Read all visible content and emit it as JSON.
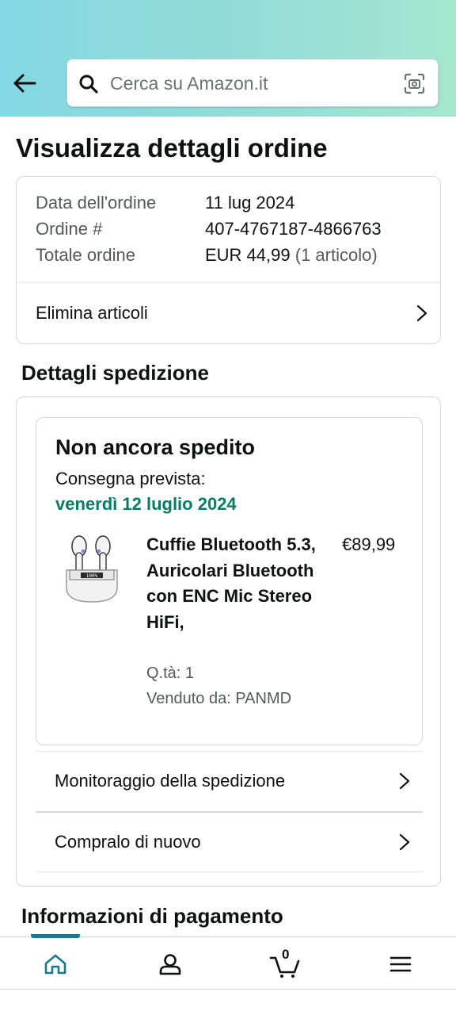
{
  "header": {
    "search_placeholder": "Cerca su Amazon.it"
  },
  "page_title": "Visualizza dettagli ordine",
  "order": {
    "date_label": "Data dell'ordine",
    "date_value": "11 lug 2024",
    "number_label": "Ordine #",
    "number_value": "407-4767187-4866763",
    "total_label": "Totale ordine",
    "total_value": "EUR 44,99",
    "total_items": "(1 articolo)",
    "delete_items_label": "Elimina articoli"
  },
  "shipping": {
    "section_title": "Dettagli spedizione",
    "status": "Non ancora spedito",
    "delivery_label": "Consegna prevista:",
    "delivery_date": "venerdì 12 luglio 2024",
    "product": {
      "name": "Cuffie Bluetooth 5.3, Auricolari Bluetooth con ENC Mic Stereo HiFi,",
      "price": "€89,99",
      "quantity": "Q.tà: 1",
      "seller": "Venduto da: PANMD"
    },
    "track_label": "Monitoraggio della spedizione",
    "buy_again_label": "Compralo di nuovo"
  },
  "payment": {
    "section_title": "Informazioni di pagamento"
  },
  "bottom_nav": {
    "cart_count": "0",
    "items": [
      "home-icon",
      "account-icon",
      "cart-icon",
      "menu-icon"
    ],
    "active": "home",
    "accent_color": "#157a8c"
  },
  "colors": {
    "delivery_green": "#067d62",
    "header_gradient_start": "#82d8e3",
    "header_gradient_end": "#a6e6cf"
  }
}
